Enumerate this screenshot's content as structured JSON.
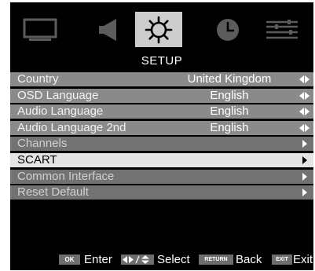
{
  "menu": {
    "tabs": [
      {
        "icon": "tv-picture-icon",
        "active": false
      },
      {
        "icon": "speaker-sound-icon",
        "active": false
      },
      {
        "icon": "gear-setup-icon",
        "active": true
      },
      {
        "icon": "clock-time-icon",
        "active": false
      },
      {
        "icon": "sliders-options-icon",
        "active": false
      }
    ],
    "title": "SETUP"
  },
  "items": [
    {
      "label": "Country",
      "value": "United Kingdom"
    },
    {
      "label": "OSD Language",
      "value": "English"
    },
    {
      "label": "Audio Language",
      "value": "English"
    },
    {
      "label": "Audio Language 2nd",
      "value": "English"
    },
    {
      "label": "Channels"
    },
    {
      "label": "SCART",
      "selected": true
    },
    {
      "label": "Common Interface"
    },
    {
      "label": "Reset Default"
    }
  ],
  "footer": {
    "ok_key": "OK",
    "enter_label": "Enter",
    "select_label": "Select",
    "return_key": "RETURN",
    "back_label": "Back",
    "exit_key": "EXIT",
    "exit_label": "Exit"
  },
  "colors": {
    "background": "#000000",
    "active_tab": "#cdcdcd",
    "row_setting": "#8a8a8a",
    "row_link": "#727272",
    "row_selected": "#e4e4e4"
  }
}
